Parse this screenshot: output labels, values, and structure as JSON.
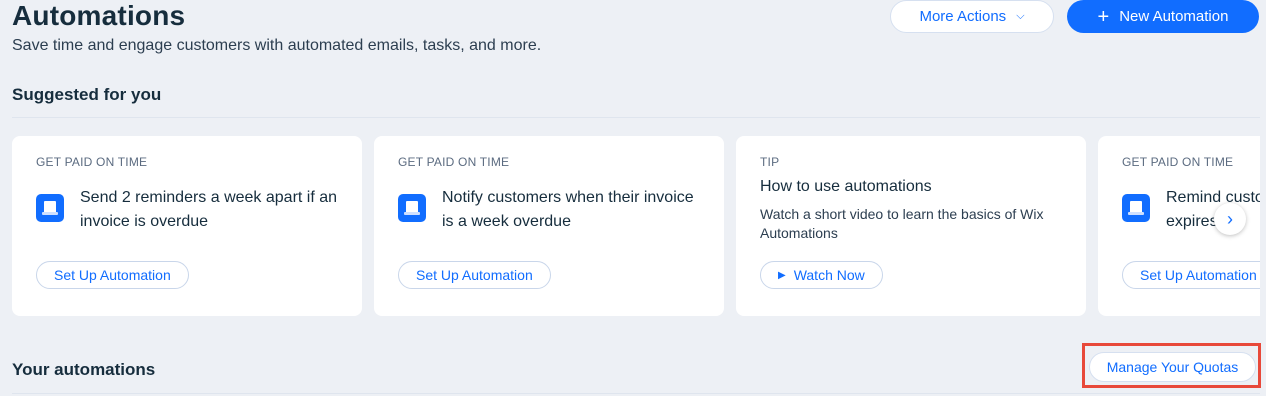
{
  "header": {
    "title": "Automations",
    "subtitle": "Save time and engage customers with automated emails, tasks, and more.",
    "more_actions_label": "More Actions",
    "new_automation_label": "New Automation"
  },
  "suggested": {
    "title": "Suggested for you",
    "cards": [
      {
        "eyebrow": "GET PAID ON TIME",
        "text": "Send 2 reminders a week apart if an invoice is overdue",
        "action": "Set Up Automation"
      },
      {
        "eyebrow": "GET PAID ON TIME",
        "text": "Notify customers when their invoice is a week overdue",
        "action": "Set Up Automation"
      },
      {
        "eyebrow": "TIP",
        "heading": "How to use automations",
        "description": "Watch a short video to learn the basics of Wix Automations",
        "action": "Watch Now"
      },
      {
        "eyebrow": "GET PAID ON TIME",
        "text": "Remind customers when their quote expires",
        "action": "Set Up Automation"
      }
    ]
  },
  "your_automations": {
    "title": "Your automations",
    "manage_quotas_label": "Manage Your Quotas"
  },
  "colors": {
    "accent": "#116dff",
    "background": "#edf0f5",
    "highlight": "#e8493a"
  }
}
